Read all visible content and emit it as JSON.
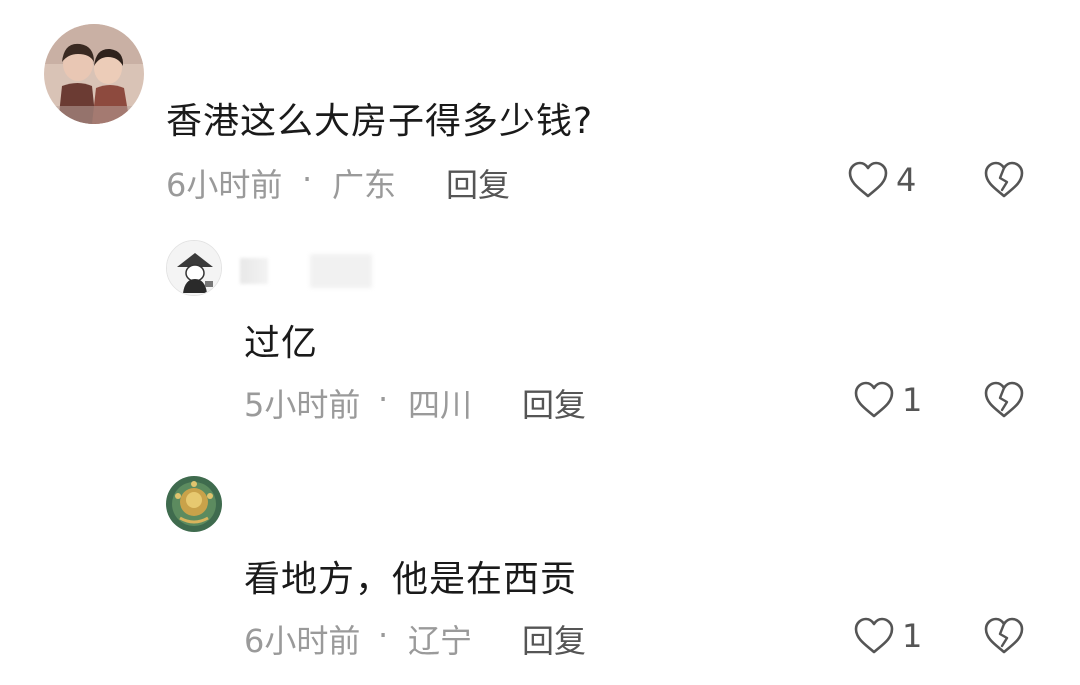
{
  "comments": [
    {
      "text": "香港这么大房子得多少钱?",
      "time": "6小时前",
      "separator": "·",
      "location": "广东",
      "reply_label": "回复",
      "likes": "4",
      "avatar_icon": "avatar-two-girls"
    },
    {
      "text": "过亿",
      "time": "5小时前",
      "separator": "·",
      "location": "四川",
      "reply_label": "回复",
      "likes": "1",
      "avatar_icon": "avatar-cartoon-figure"
    },
    {
      "text": "看地方，他是在西贡",
      "time": "6小时前",
      "separator": "·",
      "location": "辽宁",
      "reply_label": "回复",
      "likes": "1",
      "avatar_icon": "avatar-ornate-emblem"
    }
  ],
  "colors": {
    "text": "#1a1a1a",
    "meta": "#9a9a9a",
    "action": "#555555",
    "background": "#ffffff"
  }
}
